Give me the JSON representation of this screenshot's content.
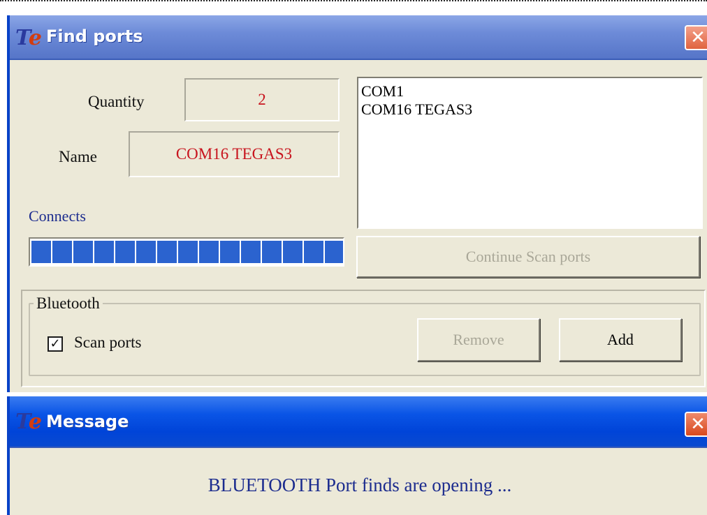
{
  "find_ports_window": {
    "title": "Find ports",
    "app_icon": "te-logo-icon",
    "quantity_label": "Quantity",
    "quantity_value": "2",
    "name_label": "Name",
    "name_value": "COM16 TEGAS3",
    "ports_list": [
      "COM1",
      "COM16 TEGAS3"
    ],
    "connects_label": "Connects",
    "progress_fraction": 1.0,
    "progress_blocks": 15,
    "continue_scan_button": "Continue Scan ports",
    "bluetooth_group": {
      "title": "Bluetooth",
      "scan_ports_label": "Scan ports",
      "scan_ports_checked": true,
      "remove_button": "Remove",
      "add_button": "Add"
    },
    "close_icon": "close-icon"
  },
  "message_window": {
    "title": "Message",
    "app_icon": "te-logo-icon",
    "text": "BLUETOOTH Port finds are opening ...",
    "close_icon": "close-icon"
  },
  "colors": {
    "titlebar_active": "#0a55e6",
    "titlebar_inactive": "#6d8bd8",
    "dialog_bg": "#ece9d8",
    "value_red": "#c8141e",
    "label_blue": "#1c2c8e",
    "progress_blue": "#2b63cf"
  }
}
